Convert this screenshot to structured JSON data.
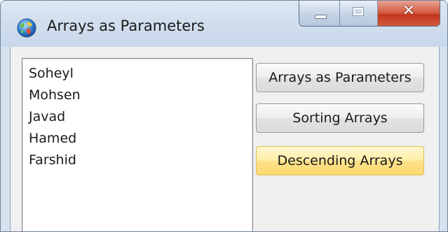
{
  "window": {
    "title": "Arrays as Parameters",
    "app_icon": "globe-icon",
    "caption_buttons": {
      "minimize": "minimize-icon",
      "maximize": "maximize-icon",
      "close": "close-icon",
      "close_glyph": "✕"
    }
  },
  "listbox": {
    "items": [
      "Soheyl",
      "Mohsen",
      "Javad",
      "Hamed",
      "Farshid"
    ]
  },
  "buttons": {
    "arrays_as_parameters": "Arrays as Parameters",
    "sorting_arrays": "Sorting Arrays",
    "descending_arrays": "Descending Arrays"
  },
  "colors": {
    "close_button": "#c2361d",
    "hovered_button": "#fde28a",
    "titlebar": "#d2dfee"
  }
}
